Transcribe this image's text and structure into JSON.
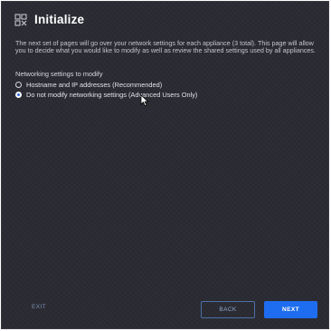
{
  "header": {
    "title": "Initialize",
    "icon": "setup-grid-icon"
  },
  "description": "The next set of pages will go over your network settings for each appliance (3 total). This page will allow you to decide what you would like to modify as well as review the shared settings used by all appliances.",
  "networking": {
    "label": "Networking settings to modify",
    "options": [
      {
        "label": "Hostname and IP addresses (Recommended)",
        "selected": false
      },
      {
        "label": "Do not modify networking settings (Advanced Users Only)",
        "selected": true
      }
    ]
  },
  "footer": {
    "exit_label": "EXIT",
    "back_label": "BACK",
    "next_label": "NEXT"
  },
  "colors": {
    "background": "#2b2c33",
    "accent": "#1e6df0",
    "outline_button": "#4b6fa8"
  }
}
